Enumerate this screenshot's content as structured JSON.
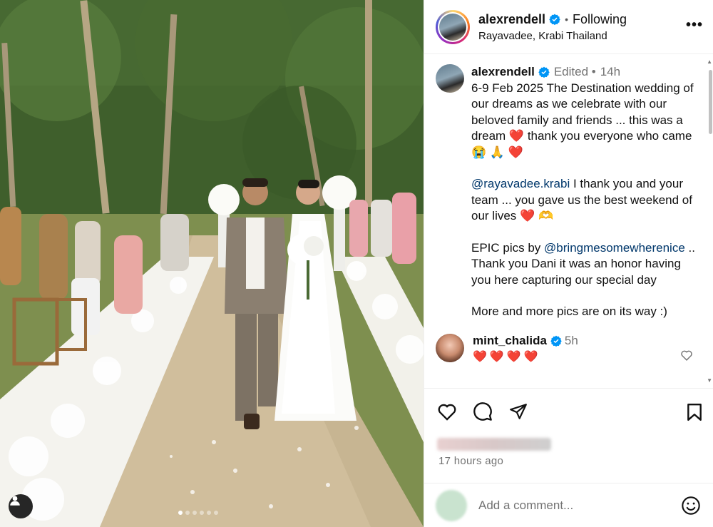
{
  "post": {
    "author": "alexrendell",
    "follow_state": "Following",
    "location": "Rayavadee, Krabi Thailand",
    "more_label": "•••"
  },
  "caption": {
    "username": "alexrendell",
    "edited": "Edited •",
    "time": "14h",
    "p1": "6-9 Feb 2025 The Destination wedding of our dreams as we celebrate with our beloved family and friends ... this was a dream",
    "p1_end": "thank you everyone who came",
    "p1_emojis": "😭 🙏",
    "heart": "❤️",
    "mention_1": "@rayavadee.krabi",
    "p2": " I thank you and your team ... you gave us the best weekend of our lives",
    "p2_emoji": "🫶",
    "p3_prefix": "EPIC pics by ",
    "mention_2": "@bringmesomewherenice",
    "p3": ".. Thank you Dani it was an honor having you here capturing our special day",
    "p4": "More and more pics are on its way :)"
  },
  "comment": {
    "username": "mint_chalida",
    "time": "5h",
    "text": "❤️❤️❤️❤️"
  },
  "footer": {
    "post_time": "17 hours ago",
    "comment_placeholder": "Add a comment..."
  },
  "icons": {
    "like": "heart-outline-icon",
    "comment": "speech-bubble-icon",
    "share": "paper-plane-icon",
    "save": "bookmark-icon",
    "emoji": "smiley-icon",
    "verified": "verified-badge-icon",
    "user_tag": "person-icon"
  },
  "colors": {
    "verified": "#0095f6",
    "mention": "#00376b",
    "heart": "#e0245e",
    "muted": "#737373"
  }
}
